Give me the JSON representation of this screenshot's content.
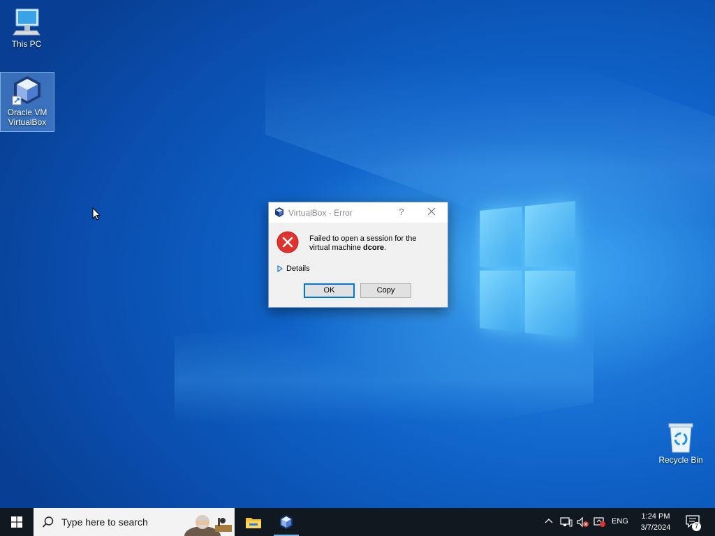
{
  "desktop": {
    "icons": [
      {
        "label": "This PC",
        "icon": "this-pc-icon"
      },
      {
        "label": "Oracle VM VirtualBox",
        "icon": "virtualbox-icon"
      },
      {
        "label": "Recycle Bin",
        "icon": "recycle-bin-icon"
      }
    ]
  },
  "dialog": {
    "title": "VirtualBox - Error",
    "help": "?",
    "message_prefix": "Failed to open a session for the virtual machine ",
    "vm_name": "dcore",
    "message_suffix": ".",
    "details_label": "Details",
    "ok_label": "OK",
    "copy_label": "Copy"
  },
  "taskbar": {
    "search_placeholder": "Type here to search",
    "apps": [
      "file-explorer-icon",
      "virtualbox-icon"
    ],
    "language": "ENG",
    "time": "1:24 PM",
    "date": "3/7/2024",
    "notification_count": "7"
  },
  "colors": {
    "accent": "#0078d7",
    "error_red": "#e0332f",
    "taskbar": "#101820"
  }
}
